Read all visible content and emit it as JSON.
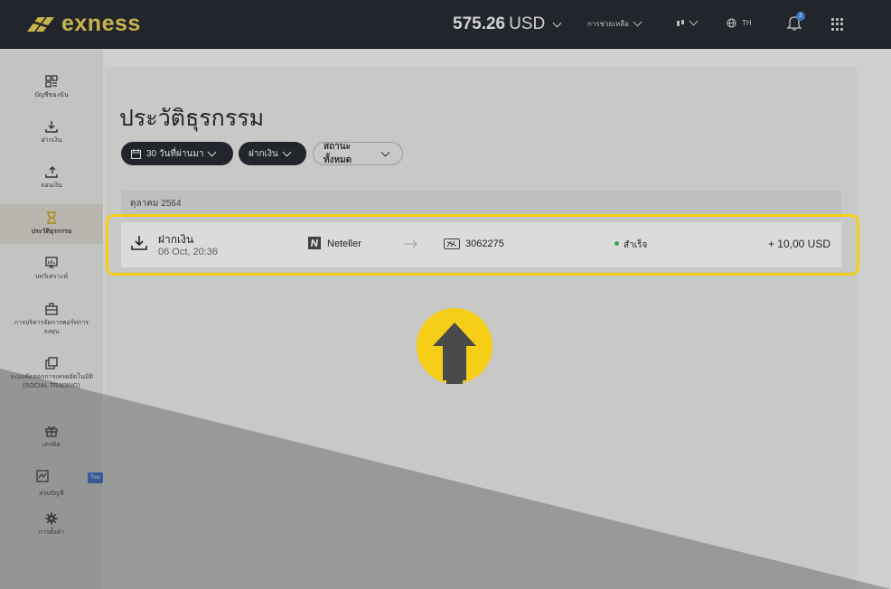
{
  "header": {
    "logo_text": "exness",
    "balance_amount": "575.26",
    "balance_currency": "USD",
    "help_label": "การช่วยเหลือ",
    "language_code": "TH",
    "notification_count": "2"
  },
  "sidebar": {
    "items": [
      {
        "label": "บัญชีของฉัน",
        "icon": "grid-icon"
      },
      {
        "label": "ฝากเงิน",
        "icon": "download-icon"
      },
      {
        "label": "ถอนเงิน",
        "icon": "upload-icon"
      },
      {
        "label": "ประวัติธุรกรรม",
        "icon": "hourglass-icon"
      },
      {
        "label": "บทวิเคราะห์",
        "icon": "analytics-icon"
      },
      {
        "label": "การบริหารจัดการพอร์ทการลงทุน",
        "icon": "briefcase-icon"
      },
      {
        "label": "ระบบคัดลอกการเทรดอัตโนมัติ (SOCIAL TRADING)",
        "icon": "copy-icon"
      },
      {
        "label": "เครดิต",
        "icon": "gift-icon"
      },
      {
        "label": "สรุปบัญชี",
        "icon": "chart-icon",
        "badge": "ใหม่"
      },
      {
        "label": "การตั้งค่า",
        "icon": "gear-icon"
      }
    ]
  },
  "page": {
    "title": "ประวัติธุรกรรม",
    "filters": {
      "period": "30 วันที่ผ่านมา",
      "type": "ฝากเงิน",
      "status": "สถานะทั้งหมด"
    },
    "group_label": "ตุลาคม 2564",
    "transaction": {
      "type": "ฝากเงิน",
      "datetime": "06 Oct, 20:36",
      "method": "Neteller",
      "account": "3062275",
      "status": "สำเร็จ",
      "amount": "+ 10,00 USD"
    }
  },
  "colors": {
    "highlight": "#f6cd17",
    "success": "#35b55a",
    "topbar": "#1f232b"
  }
}
